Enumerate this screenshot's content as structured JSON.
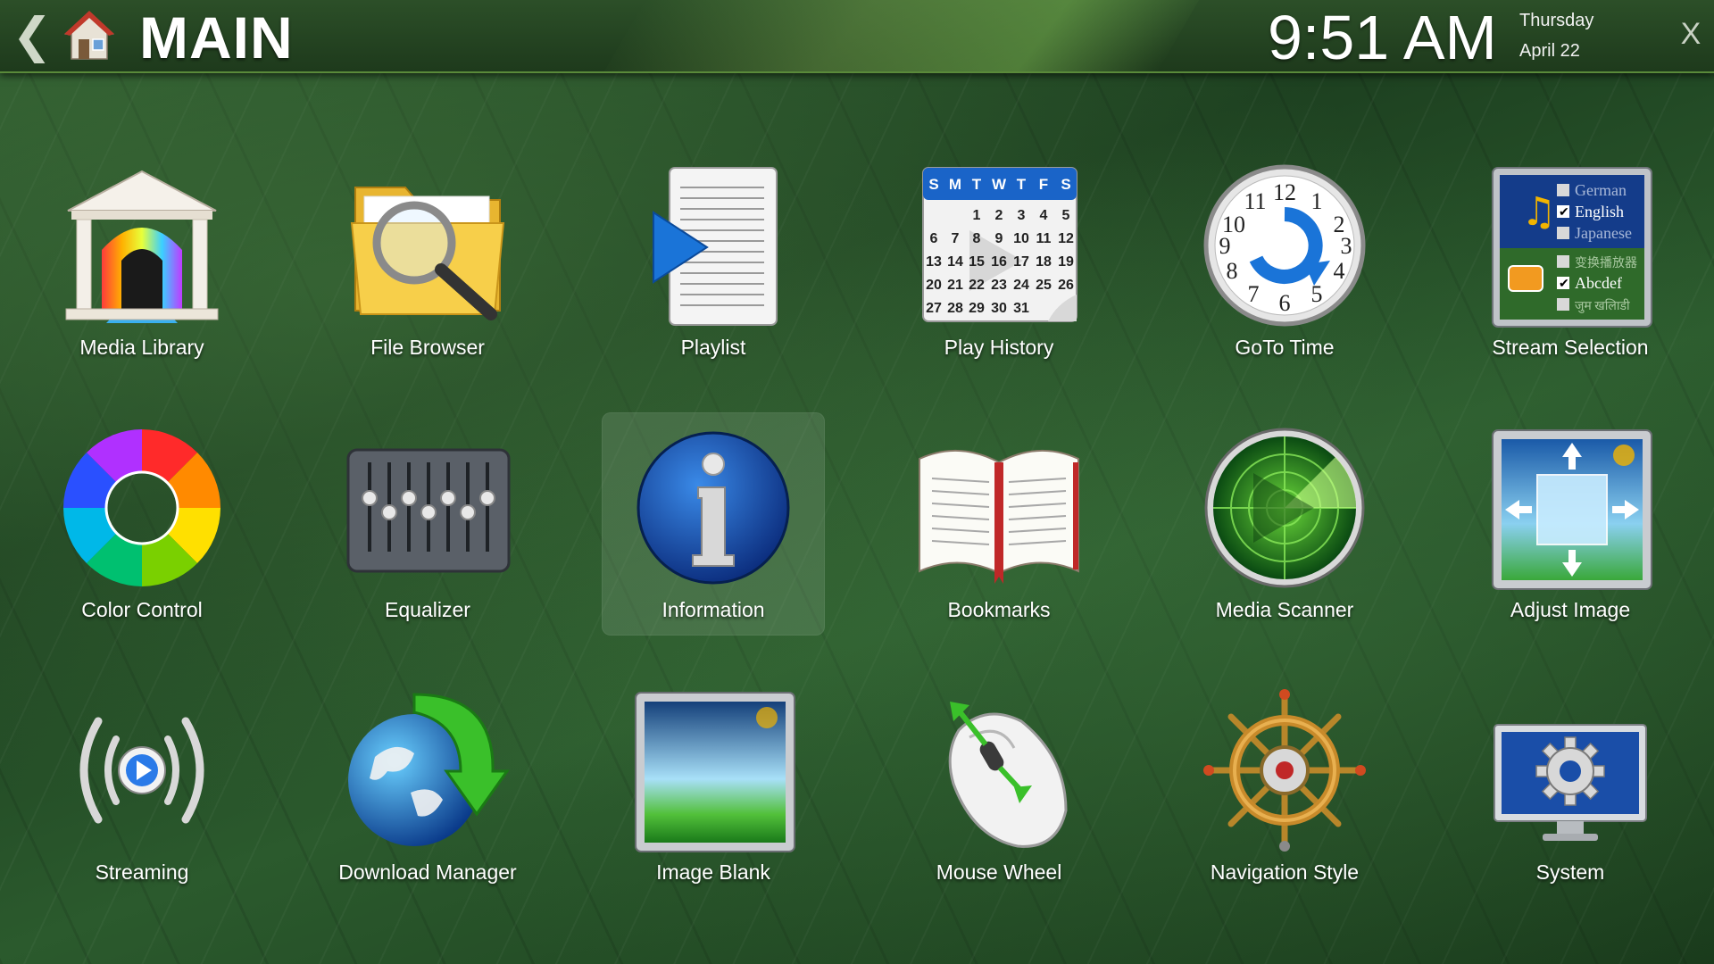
{
  "header": {
    "title": "MAIN",
    "time": "9:51 AM",
    "day": "Thursday",
    "date": "April 22",
    "back_glyph": "❮",
    "close_glyph": "X"
  },
  "menu": {
    "selected": "Information",
    "items": [
      {
        "label": "Media Library",
        "icon": "media-library-icon"
      },
      {
        "label": "File Browser",
        "icon": "file-browser-icon"
      },
      {
        "label": "Playlist",
        "icon": "playlist-icon"
      },
      {
        "label": "Play History",
        "icon": "play-history-icon"
      },
      {
        "label": "GoTo Time",
        "icon": "goto-time-icon"
      },
      {
        "label": "Stream Selection",
        "icon": "stream-selection-icon"
      },
      {
        "label": "Color Control",
        "icon": "color-control-icon"
      },
      {
        "label": "Equalizer",
        "icon": "equalizer-icon"
      },
      {
        "label": "Information",
        "icon": "information-icon"
      },
      {
        "label": "Bookmarks",
        "icon": "bookmarks-icon"
      },
      {
        "label": "Media Scanner",
        "icon": "media-scanner-icon"
      },
      {
        "label": "Adjust Image",
        "icon": "adjust-image-icon"
      },
      {
        "label": "Streaming",
        "icon": "streaming-icon"
      },
      {
        "label": "Download Manager",
        "icon": "download-manager-icon"
      },
      {
        "label": "Image Blank",
        "icon": "image-blank-icon"
      },
      {
        "label": "Mouse Wheel",
        "icon": "mouse-wheel-icon"
      },
      {
        "label": "Navigation Style",
        "icon": "navigation-style-icon"
      },
      {
        "label": "System",
        "icon": "system-icon"
      }
    ]
  },
  "calendar": {
    "headers": [
      "S",
      "M",
      "T",
      "W",
      "T",
      "F",
      "S"
    ],
    "rows": [
      [
        "",
        "",
        "1",
        "2",
        "3",
        "4",
        "5"
      ],
      [
        "6",
        "7",
        "8",
        "9",
        "10",
        "11",
        "12"
      ],
      [
        "13",
        "14",
        "15",
        "16",
        "17",
        "18",
        "19"
      ],
      [
        "20",
        "21",
        "22",
        "23",
        "24",
        "25",
        "26"
      ],
      [
        "27",
        "28",
        "29",
        "30",
        "31",
        "",
        ""
      ]
    ]
  },
  "stream_selection": {
    "audio": [
      {
        "label": "German",
        "checked": false
      },
      {
        "label": "English",
        "checked": true
      },
      {
        "label": "Japanese",
        "checked": false
      }
    ],
    "subtitles": [
      {
        "label": "变换播放器",
        "checked": false
      },
      {
        "label": "Abcdef",
        "checked": true
      },
      {
        "label": "जुम खलिाडी",
        "checked": false
      }
    ]
  },
  "colors": {
    "accent": "#5a8a3a",
    "text": "#ffffff",
    "selection": "#b4c8b4"
  }
}
